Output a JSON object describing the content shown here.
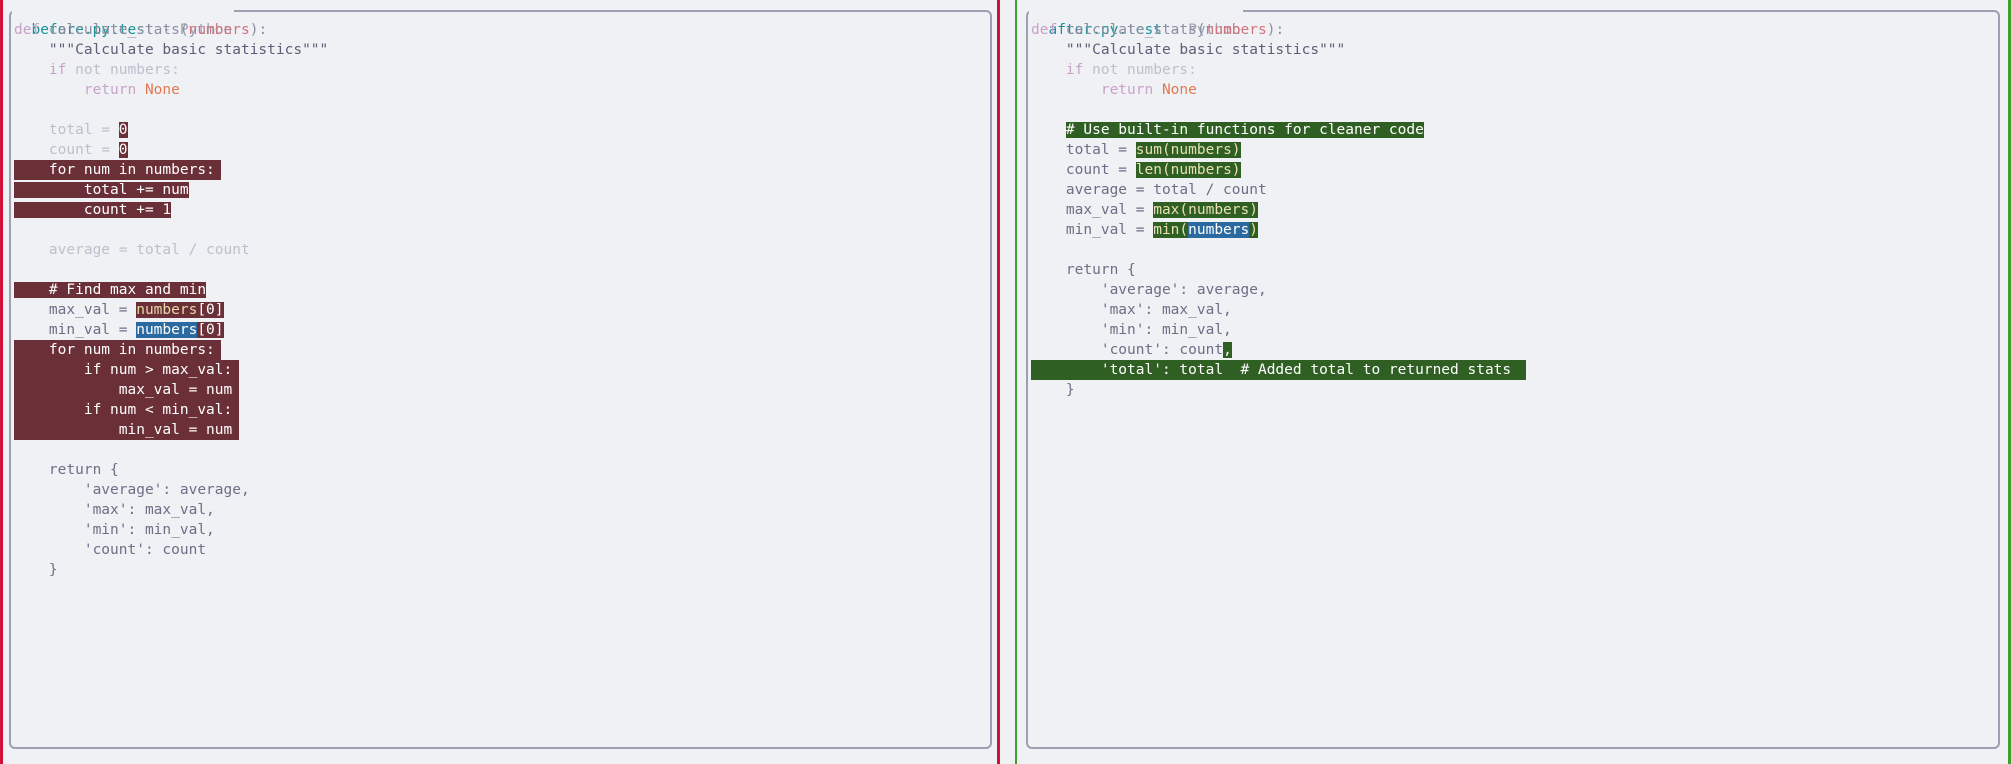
{
  "colors": {
    "removed_accent": "#d20f39",
    "added_accent": "#40a02b",
    "removed_highlight": "#6b2f37",
    "added_highlight": "#2f5f22",
    "selection": "#2a6aa0",
    "filename": "#179299"
  },
  "left": {
    "filename": "before.py.test",
    "separator": " - ",
    "language": "Python",
    "lines": {
      "l1_def": "def ",
      "l1_fn": "calculate_stats(",
      "l1_param": "numbers",
      "l1_end": "):",
      "l2": "    \"\"\"Calculate basic statistics\"\"\"",
      "l3_kw": "    if",
      "l3_rest": " not numbers:",
      "l4_ret": "        return ",
      "l4_none": "None",
      "l6_a": "    total = ",
      "l6_b": "0",
      "l7_a": "    count = ",
      "l7_b": "0",
      "l8": "    for num in numbers:",
      "l9": "        total += num",
      "l10": "        count += 1",
      "l12": "    average = total / count",
      "l14": "    # Find max and min",
      "l15_a": "    max_val = ",
      "l15_b": "numbers",
      "l15_c": "[0]",
      "l16_a": "    min_val = ",
      "l16_b": "numbers",
      "l16_c": "[0]",
      "l17": "    for num in numbers:",
      "l18": "        if num > max_val:",
      "l19": "            max_val = num",
      "l20": "        if num < min_val:",
      "l21": "            min_val = num",
      "l23": "    return {",
      "l24": "        'average': average,",
      "l25": "        'max': max_val,",
      "l26": "        'min': min_val,",
      "l27": "        'count': count",
      "l28": "    }"
    }
  },
  "right": {
    "filename": "after.py.test",
    "separator": " - ",
    "language": "Python",
    "lines": {
      "l1_def": "def ",
      "l1_fn": "calculate_stats(",
      "l1_param": "numbers",
      "l1_end": "):",
      "l2": "    \"\"\"Calculate basic statistics\"\"\"",
      "l3_kw": "    if",
      "l3_rest": " not numbers:",
      "l4_ret": "        return ",
      "l4_none": "None",
      "l6": "# Use built-in functions for cleaner code",
      "l7_a": "    total = ",
      "l7_b": "sum(numbers)",
      "l8_a": "    count = ",
      "l8_b": "len(numbers)",
      "l9": "    average = total / count",
      "l10_a": "    max_val = ",
      "l10_b": "max(numbers)",
      "l11_a": "    min_val = ",
      "l11_b": "min(",
      "l11_c": "numbers",
      "l11_d": ")",
      "l13": "    return {",
      "l14": "        'average': average,",
      "l15": "        'max': max_val,",
      "l16": "        'min': min_val,",
      "l17_a": "        'count': count",
      "l17_b": ",",
      "l18": "        'total': total  # Added total to returned stats",
      "l19": "    }"
    }
  }
}
